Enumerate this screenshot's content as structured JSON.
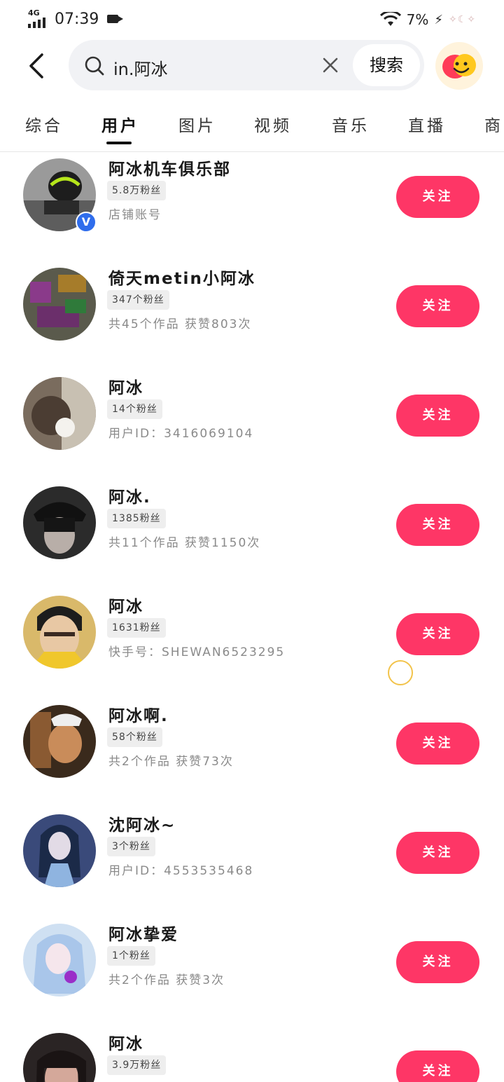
{
  "status_bar": {
    "network": "4G",
    "time": "07:39",
    "battery": "7%"
  },
  "search": {
    "query": "in.阿冰",
    "button_label": "搜索"
  },
  "tabs": [
    {
      "label": "综合",
      "active": false
    },
    {
      "label": "用户",
      "active": true
    },
    {
      "label": "图片",
      "active": false
    },
    {
      "label": "视频",
      "active": false
    },
    {
      "label": "音乐",
      "active": false
    },
    {
      "label": "直播",
      "active": false
    },
    {
      "label": "商品",
      "active": false
    }
  ],
  "results": [
    {
      "name": "阿冰机车俱乐部",
      "fans": "5.8万粉丝",
      "meta": "店铺账号",
      "verified": true,
      "follow": "关注"
    },
    {
      "name": "倚天metin小阿冰",
      "fans": "347个粉丝",
      "meta": "共45个作品 获赞803次",
      "verified": false,
      "follow": "关注"
    },
    {
      "name": "阿冰",
      "fans": "14个粉丝",
      "meta": "用户ID：3416069104",
      "verified": false,
      "follow": "关注"
    },
    {
      "name": "阿冰.",
      "fans": "1385粉丝",
      "meta": "共11个作品 获赞1150次",
      "verified": false,
      "follow": "关注"
    },
    {
      "name": "阿冰",
      "fans": "1631粉丝",
      "meta": "快手号：SHEWAN6523295",
      "verified": false,
      "follow": "关注"
    },
    {
      "name": "阿冰啊.",
      "fans": "58个粉丝",
      "meta": "共2个作品 获赞73次",
      "verified": false,
      "follow": "关注"
    },
    {
      "name": "沈阿冰~",
      "fans": "3个粉丝",
      "meta": "用户ID：4553535468",
      "verified": false,
      "follow": "关注"
    },
    {
      "name": "阿冰挚爱",
      "fans": "1个粉丝",
      "meta": "共2个作品 获赞3次",
      "verified": false,
      "follow": "关注"
    },
    {
      "name": "阿冰",
      "fans": "3.9万粉丝",
      "meta": "",
      "verified": false,
      "follow": "关注"
    }
  ],
  "colors": {
    "accent": "#fe3666",
    "verified": "#2f6dec",
    "search_bg": "#f1f2f5"
  }
}
